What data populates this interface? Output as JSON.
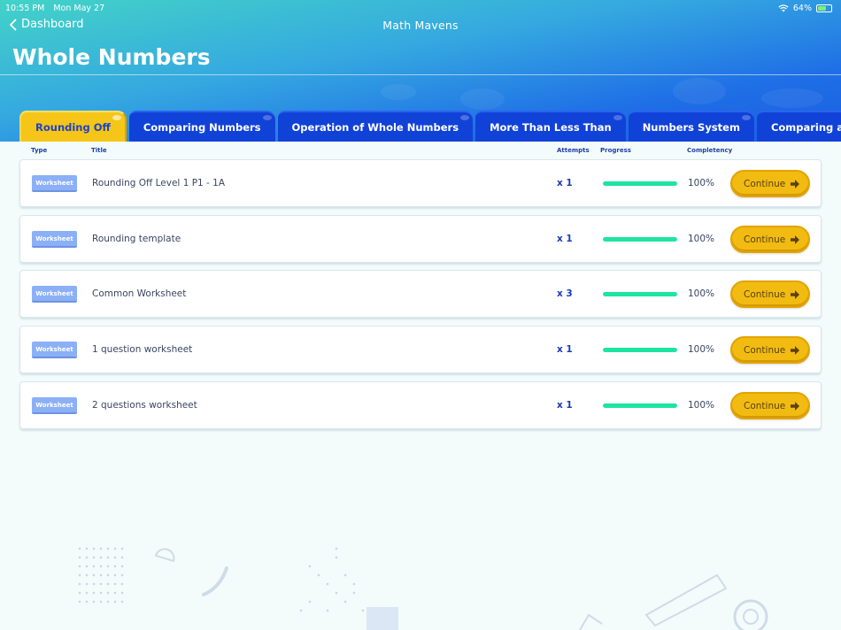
{
  "status": {
    "time": "10:55 PM",
    "date": "Mon May 27",
    "battery": "64%"
  },
  "nav": {
    "back_label": "Dashboard",
    "app_title": "Math Mavens"
  },
  "page": {
    "title": "Whole Numbers"
  },
  "tabs": [
    {
      "label": "Rounding Off",
      "active": true
    },
    {
      "label": "Comparing Numbers",
      "active": false
    },
    {
      "label": "Operation of Whole Numbers",
      "active": false
    },
    {
      "label": "More Than Less Than",
      "active": false
    },
    {
      "label": "Numbers System",
      "active": false
    },
    {
      "label": "Comparing and Ordering whole nu",
      "active": false
    }
  ],
  "columns": {
    "type": "Type",
    "title": "Title",
    "attempts": "Attempts",
    "progress": "Progress",
    "completeness": "Completency"
  },
  "rows": [
    {
      "type": "Worksheet",
      "title": "Rounding Off Level 1 P1 - 1A",
      "attempts": "x 1",
      "progress": 1.0,
      "completeness": "100%",
      "action": "Continue"
    },
    {
      "type": "Worksheet",
      "title": "Rounding template",
      "attempts": "x 1",
      "progress": 1.0,
      "completeness": "100%",
      "action": "Continue"
    },
    {
      "type": "Worksheet",
      "title": "Common Worksheet",
      "attempts": "x 3",
      "progress": 1.0,
      "completeness": "100%",
      "action": "Continue"
    },
    {
      "type": "Worksheet",
      "title": "1 question worksheet",
      "attempts": "x 1",
      "progress": 1.0,
      "completeness": "100%",
      "action": "Continue"
    },
    {
      "type": "Worksheet",
      "title": "2 questions worksheet",
      "attempts": "x 1",
      "progress": 1.0,
      "completeness": "100%",
      "action": "Continue"
    }
  ],
  "colors": {
    "accent": "#f2bb12",
    "tab_blue": "#1142d8",
    "progress": "#1de4a0",
    "badge": "#8bb0f7"
  },
  "icons": {
    "back": "chevron-left-icon",
    "wifi": "wifi-icon",
    "battery": "battery-icon",
    "continue": "arrow-right-icon"
  }
}
